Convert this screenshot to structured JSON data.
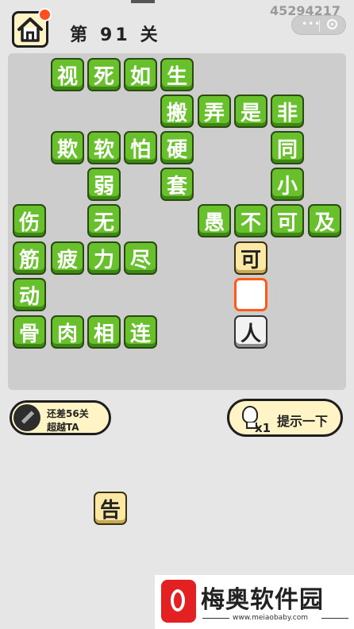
{
  "header": {
    "level_prefix": "第",
    "level_number": "91",
    "level_suffix": "关",
    "user_id": "45294217",
    "capsule_dots": "•••"
  },
  "board": {
    "tiles": [
      {
        "char": "视",
        "style": "green"
      },
      {
        "char": "死",
        "style": "green"
      },
      {
        "char": "如",
        "style": "green"
      },
      {
        "char": "生",
        "style": "green"
      },
      {
        "char": "搬",
        "style": "green"
      },
      {
        "char": "弄",
        "style": "green"
      },
      {
        "char": "是",
        "style": "green"
      },
      {
        "char": "非",
        "style": "green"
      },
      {
        "char": "欺",
        "style": "green"
      },
      {
        "char": "软",
        "style": "green"
      },
      {
        "char": "怕",
        "style": "green"
      },
      {
        "char": "硬",
        "style": "green"
      },
      {
        "char": "同",
        "style": "green"
      },
      {
        "char": "弱",
        "style": "green"
      },
      {
        "char": "套",
        "style": "green"
      },
      {
        "char": "小",
        "style": "green"
      },
      {
        "char": "伤",
        "style": "green"
      },
      {
        "char": "无",
        "style": "green"
      },
      {
        "char": "愚",
        "style": "green"
      },
      {
        "char": "不",
        "style": "green"
      },
      {
        "char": "可",
        "style": "green"
      },
      {
        "char": "及",
        "style": "green"
      },
      {
        "char": "筋",
        "style": "green"
      },
      {
        "char": "疲",
        "style": "green"
      },
      {
        "char": "力",
        "style": "green"
      },
      {
        "char": "尽",
        "style": "green"
      },
      {
        "char": "可",
        "style": "cream"
      },
      {
        "char": "动",
        "style": "green"
      },
      {
        "char": "",
        "style": "blank"
      },
      {
        "char": "骨",
        "style": "green"
      },
      {
        "char": "肉",
        "style": "green"
      },
      {
        "char": "相",
        "style": "green"
      },
      {
        "char": "连",
        "style": "green"
      },
      {
        "char": "人",
        "style": "grey"
      }
    ]
  },
  "rank": {
    "line1": "还差56关",
    "line2": "超越TA"
  },
  "hint": {
    "count": "x1",
    "label": "提示一下"
  },
  "answer_choices": [
    {
      "char": "告"
    }
  ],
  "watermark": {
    "title": "梅奥软件园",
    "url": "www.meiaobaby.com"
  }
}
